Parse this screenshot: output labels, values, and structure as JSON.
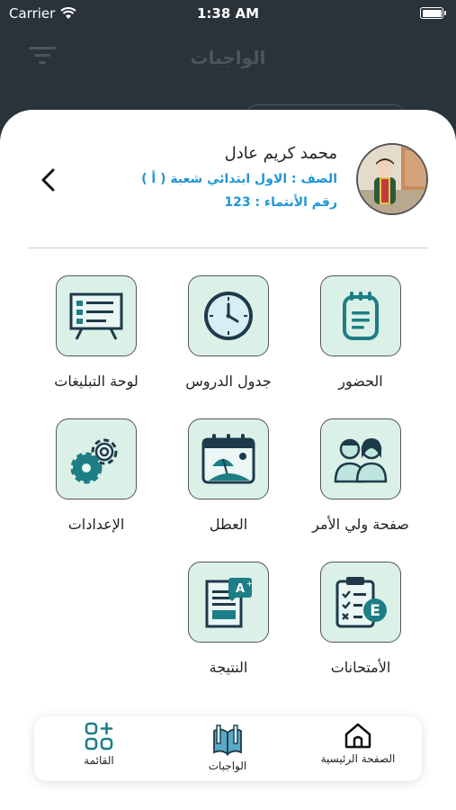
{
  "status_bar": {
    "carrier": "Carrier",
    "time": "1:38 AM"
  },
  "background": {
    "title": "الواجبات"
  },
  "profile": {
    "name": "محمد كريم عادل",
    "class_line": "الصف : الاول ابتدائي شعبة ( أ )",
    "id_line": "رقم الأنتماء : 123"
  },
  "menu": [
    {
      "label": "الحضور",
      "icon": "notepad-icon"
    },
    {
      "label": "جدول الدروس",
      "icon": "clock-icon"
    },
    {
      "label": "لوحة التبليغات",
      "icon": "presentation-board-icon"
    },
    {
      "label": "صفحة ولي الأمر",
      "icon": "parents-icon"
    },
    {
      "label": "العطل",
      "icon": "holiday-calendar-icon"
    },
    {
      "label": "الإعدادات",
      "icon": "gears-icon"
    },
    {
      "label": "الأمتحانات",
      "icon": "exam-clipboard-icon"
    },
    {
      "label": "النتيجة",
      "icon": "result-document-icon"
    }
  ],
  "bottom_nav": {
    "home": "الصفحة الرئيسية",
    "homework": "الواجبات",
    "menu": "القائمة"
  },
  "colors": {
    "tile_bg": "#dbf1e7",
    "icon_teal": "#1d7e86",
    "link_blue": "#2196d6",
    "dark_bg": "#2a333b"
  }
}
